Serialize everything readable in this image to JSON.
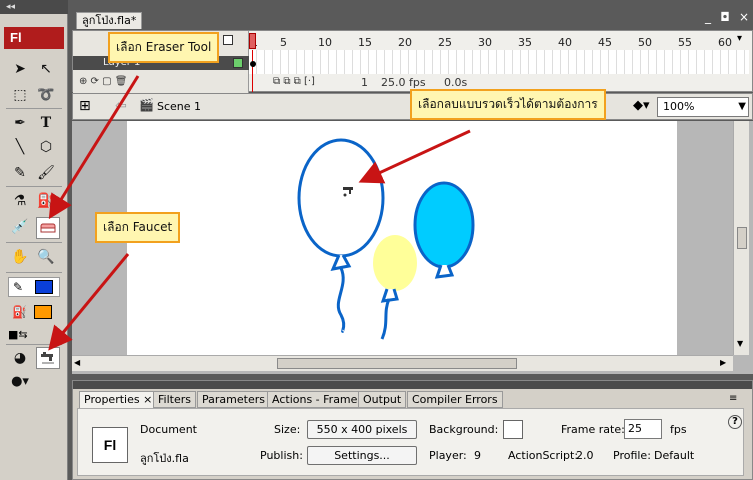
{
  "tools": {
    "header": "◂◂",
    "logo": "Fl"
  },
  "document": {
    "tab_title": "ลูกโป่ง.fla*",
    "window_controls": [
      "_",
      "◘",
      "×"
    ]
  },
  "timeline": {
    "layer_name": "Layer 1",
    "frame_numbers": [
      "1",
      "5",
      "10",
      "15",
      "20",
      "25",
      "30",
      "35",
      "40",
      "45",
      "50",
      "55",
      "60"
    ],
    "current_frame": "1",
    "frame_rate": "25.0 fps",
    "elapsed": "0.0s"
  },
  "editbar": {
    "scene": "Scene 1",
    "zoom": "100%"
  },
  "callouts": {
    "eraser": "เลือก Eraser Tool",
    "faucet": "เลือก Faucet",
    "speed": "เลือกลบแบบรวดเร็วได้ตามต้องการ"
  },
  "properties": {
    "tabs": [
      "Properties",
      "Filters",
      "Parameters",
      "Actions - Frame",
      "Output",
      "Compiler Errors"
    ],
    "tab_close": "×",
    "doc_icon": "Fl",
    "doc_label": "Document",
    "doc_name": "ลูกโป่ง.fla",
    "size_label": "Size:",
    "size_value": "550 x 400 pixels",
    "publish_label": "Publish:",
    "publish_value": "Settings...",
    "background_label": "Background:",
    "player_label": "Player:",
    "player_value": "9",
    "actionscript_label": "ActionScript:",
    "actionscript_value": "2.0",
    "framerate_label": "Frame rate:",
    "framerate_value": "25",
    "fps_label": "fps",
    "profile_label": "Profile:",
    "profile_value": "Default",
    "help": "?"
  },
  "colors": {
    "stroke": "#0a64c8",
    "fill": "#0000ff",
    "fill2": "#ff9900",
    "balloon_blue": "#00ccff",
    "balloon_yellow": "#ffff99",
    "callout_border": "#f2a11e",
    "arrow": "#c81414"
  }
}
